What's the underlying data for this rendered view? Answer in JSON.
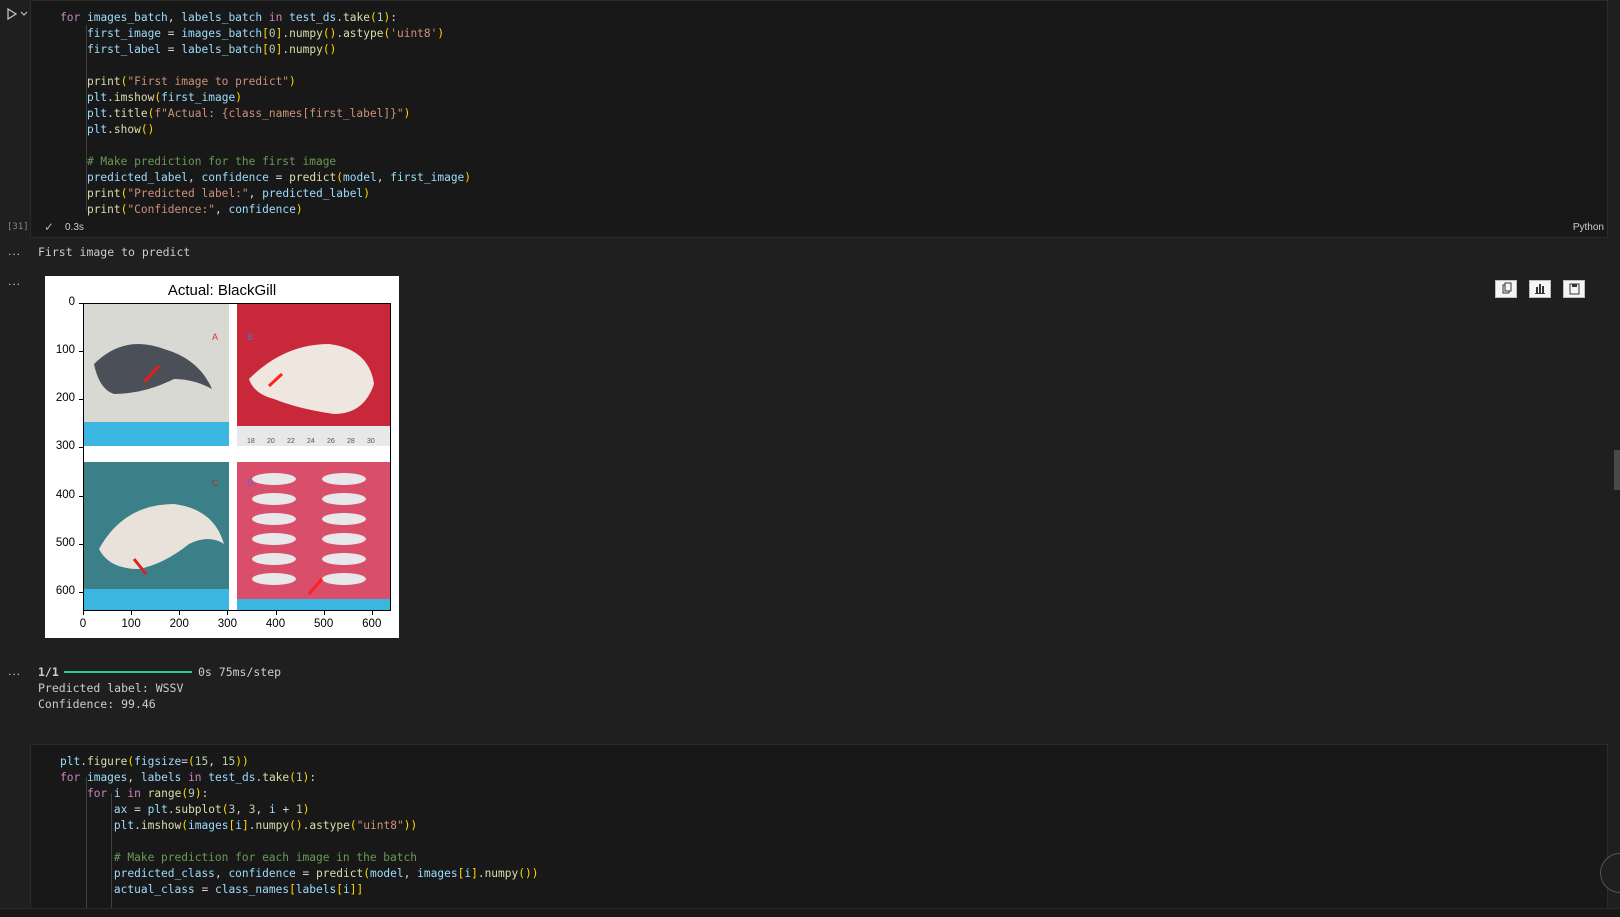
{
  "cell1": {
    "exec_count": "[31]",
    "time": "0.3s",
    "language": "Python",
    "lines": [
      "for images_batch, labels_batch in test_ds.take(1):",
      "    first_image = images_batch[0].numpy().astype('uint8')",
      "    first_label = labels_batch[0].numpy()",
      "",
      "    print(\"First image to predict\")",
      "    plt.imshow(first_image)",
      "    plt.title(f\"Actual: {class_names[first_label]}\")",
      "    plt.show()",
      "",
      "    # Make prediction for the first image",
      "    predicted_label, confidence = predict(model, first_image)",
      "    print(\"Predicted label:\", predicted_label)",
      "    print(\"Confidence:\", confidence)"
    ]
  },
  "outputs": {
    "ellipsis": "...",
    "text1": "First image to predict",
    "figure_title": "Actual: BlackGill",
    "y_ticks": [
      "0",
      "100",
      "200",
      "300",
      "400",
      "500",
      "600"
    ],
    "x_ticks": [
      "0",
      "100",
      "200",
      "300",
      "400",
      "500",
      "600"
    ],
    "panel_labels": [
      "A",
      "B",
      "C",
      "D"
    ],
    "ruler_ticks": [
      "18",
      "20",
      "22",
      "24",
      "26",
      "28",
      "30"
    ],
    "progress_step": "1/1",
    "progress_time": "0s 75ms/step",
    "progress": 1.0,
    "predicted": "Predicted label: WSSV",
    "confidence": "Confidence: 99.46"
  },
  "cell2": {
    "lines": [
      "plt.figure(figsize=(15, 15))",
      "for images, labels in test_ds.take(1):",
      "    for i in range(9):",
      "        ax = plt.subplot(3, 3, i + 1)",
      "        plt.imshow(images[i].numpy().astype(\"uint8\"))",
      "",
      "        # Make prediction for each image in the batch",
      "        predicted_class, confidence = predict(model, images[i].numpy())",
      "        actual_class = class_names[labels[i]]"
    ]
  },
  "icons": {
    "run": "run-icon",
    "chevron": "chevron-down-icon",
    "check": "check-icon",
    "copy": "copy-icon",
    "chart": "chart-icon",
    "save": "save-icon"
  },
  "colors": {
    "progress": "#23d18b",
    "keyword": "#c586c0",
    "function": "#dcdcaa",
    "variable": "#9cdcfe",
    "string": "#ce9178",
    "comment": "#6a9955"
  }
}
